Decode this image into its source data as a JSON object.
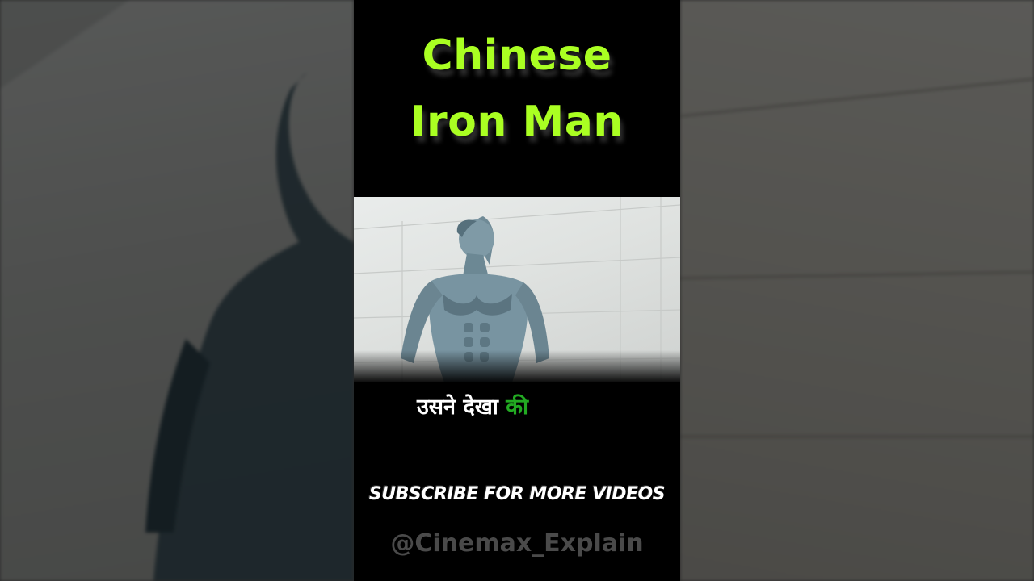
{
  "video": {
    "title_line1": "Chinese",
    "title_line2": "Iron Man",
    "caption_main": "उसने देखा",
    "caption_highlight": "की",
    "subscribe_text": "SUBSCRIBE FOR MORE VIDEOS",
    "channel_handle": "@Cinemax_Explain"
  },
  "colors": {
    "title": "#aaff22",
    "caption_highlight": "#22aa22",
    "handle": "#4a4a4a",
    "background": "#000000"
  }
}
